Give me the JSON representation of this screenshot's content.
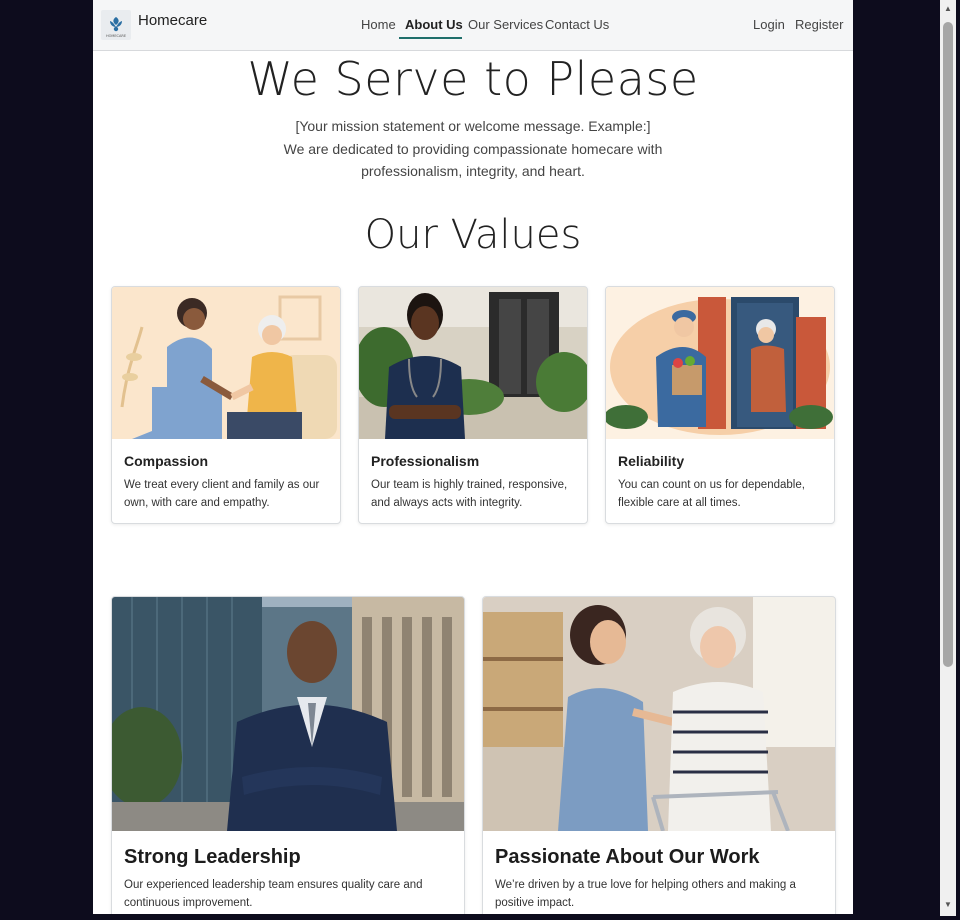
{
  "nav": {
    "brand": "Homecare",
    "logo_text": "HOMECARE",
    "links": [
      "Home",
      "About Us",
      "Our Services",
      "Contact Us"
    ],
    "active": "About Us",
    "login": "Login",
    "register": "Register"
  },
  "hero": {
    "title": "We Serve to Please",
    "line1": "[Your mission statement or welcome message. Example:]",
    "line2": "We are dedicated to providing compassionate homecare with",
    "line3": "professionalism, integrity, and heart."
  },
  "values": {
    "title": "Our Values",
    "cards": [
      {
        "title": "Compassion",
        "text1": "We treat every client and family as our",
        "text2": "own, with care and empathy."
      },
      {
        "title": "Professionalism",
        "text1": "Our team is highly trained, responsive,",
        "text2": "and always acts with integrity."
      },
      {
        "title": "Reliability",
        "text1": "You can count on us for dependable,",
        "text2": "flexible care at all times."
      }
    ]
  },
  "features": [
    {
      "title": "Strong Leadership",
      "text1": "Our experienced leadership team ensures quality care and",
      "text2": "continuous improvement."
    },
    {
      "title": "Passionate About Our Work",
      "text1": "We’re driven by a true love for helping others and making a",
      "text2": "positive impact."
    }
  ],
  "colors": {
    "accent": "#1f6f6b",
    "page_bg": "#0d0c1d"
  }
}
